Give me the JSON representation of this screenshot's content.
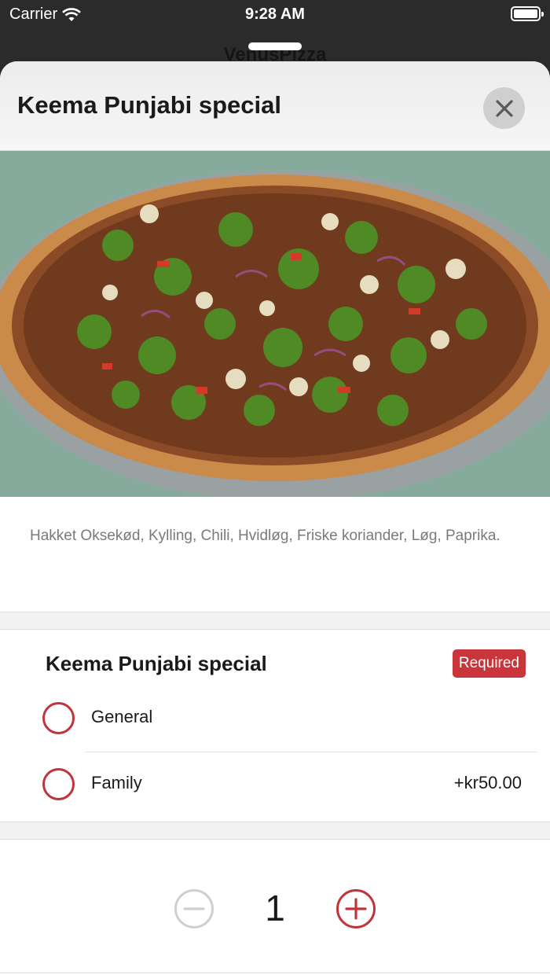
{
  "status_bar": {
    "carrier": "Carrier",
    "time": "9:28 AM"
  },
  "background_title": "VenusPizza",
  "sheet": {
    "title": "Keema Punjabi special",
    "close_icon": "close-icon",
    "description": "Hakket Oksekød, Kylling, Chili, Hvidløg, Friske koriander, Løg, Paprika."
  },
  "option_group": {
    "title": "Keema Punjabi special",
    "required_label": "Required",
    "options": [
      {
        "label": "General",
        "price": ""
      },
      {
        "label": "Family",
        "price": "+kr50.00"
      }
    ]
  },
  "quantity": {
    "value": "1",
    "minus_icon": "minus-circle-icon",
    "plus_icon": "plus-circle-icon"
  },
  "colors": {
    "accent": "#c0353b",
    "disabled": "#cfcfcf"
  }
}
